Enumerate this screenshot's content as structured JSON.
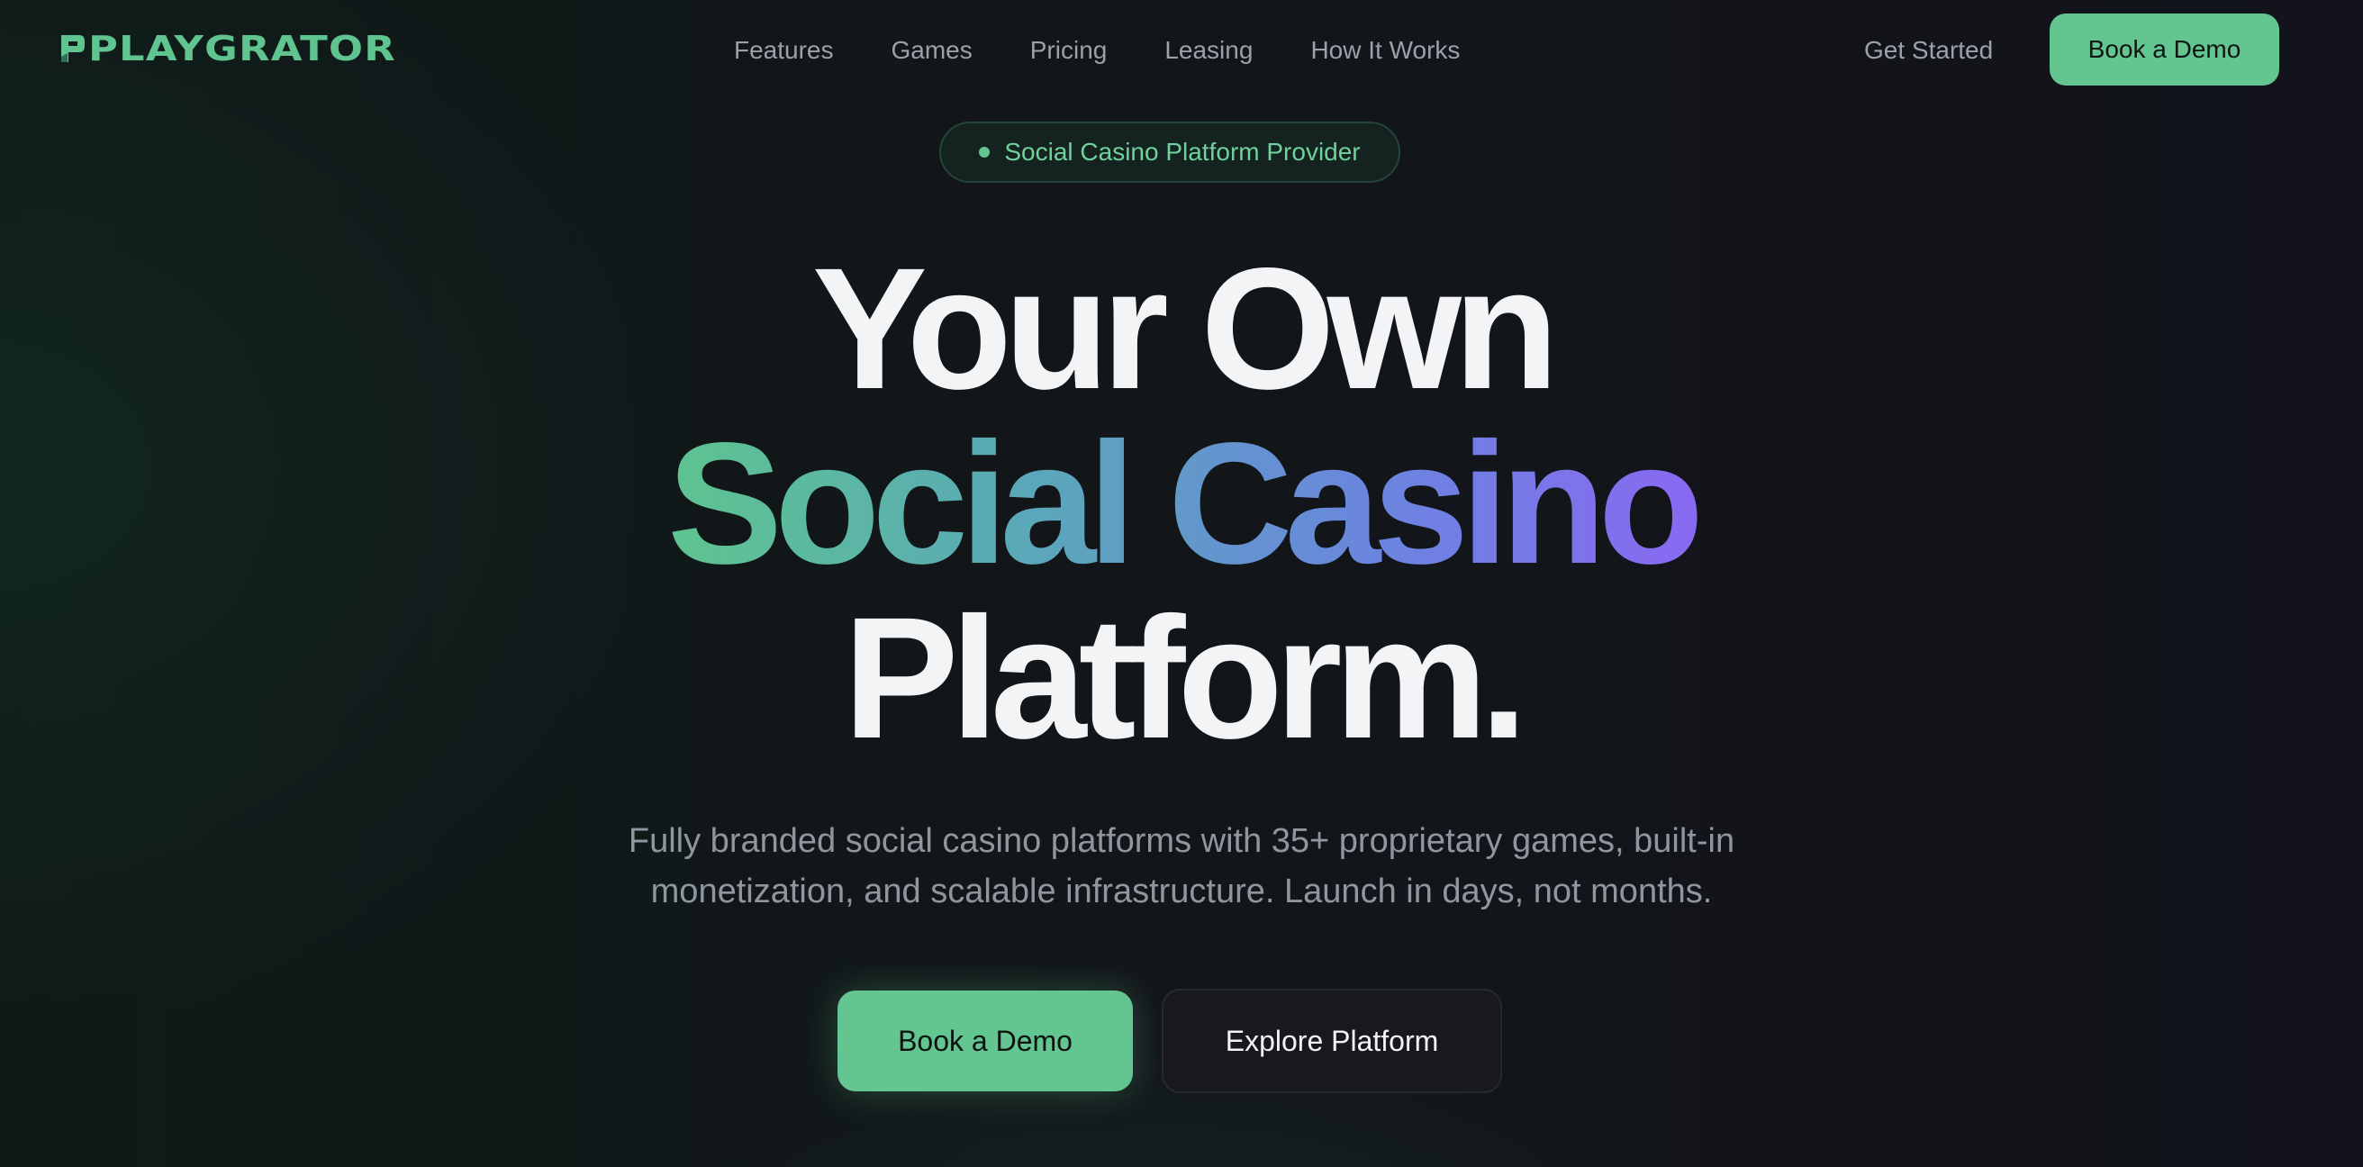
{
  "brand": {
    "name": "PLAYGRATOR",
    "color": "#5fc48f"
  },
  "nav": {
    "links": [
      "Features",
      "Games",
      "Pricing",
      "Leasing",
      "How It Works"
    ],
    "get_started": "Get Started",
    "book_demo": "Book a Demo"
  },
  "hero": {
    "badge": "Social Casino Platform Provider",
    "headline_line1": "Your Own",
    "headline_line2": "Social Casino",
    "headline_line3": "Platform.",
    "subtext": "Fully branded social casino platforms with 35+ proprietary games, built-in monetization, and scalable infrastructure. Launch in days, not months.",
    "cta_primary": "Book a Demo",
    "cta_secondary": "Explore Platform"
  },
  "colors": {
    "accent": "#63c58f",
    "gradient_start": "#5ec58e",
    "gradient_end": "#8a68f2",
    "background": "#111419"
  }
}
